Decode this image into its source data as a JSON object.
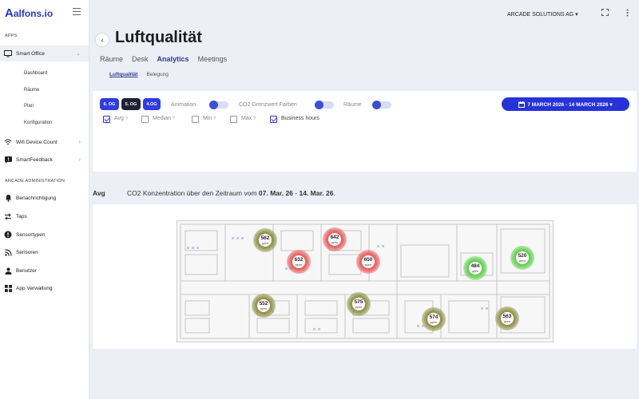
{
  "app": {
    "logo_mark": "A",
    "logo_text": "alfons.io",
    "org": "ARCADE SOLUTIONS AG ▾"
  },
  "sidebar": {
    "apps_label": "APPS",
    "smart_office": "Smart Office",
    "sub_items": [
      "Dashboard",
      "Räume",
      "Plan",
      "Konfiguration"
    ],
    "wifi": "Wifi Device Count",
    "smartfeedback": "SmartFeedback",
    "admin_label": "ARCADE ADMINISTRATION",
    "admin_items": [
      "Benachrichtigung",
      "Taps",
      "Sensortypen",
      "Sensoren",
      "Benutzer",
      "App Verwaltung"
    ]
  },
  "header": {
    "title": "Luftqualität",
    "tabs": [
      "Räume",
      "Desk",
      "Analytics",
      "Meetings"
    ],
    "active_tab": "Analytics",
    "subtabs": [
      "Luftqualität",
      "Belegung"
    ]
  },
  "filters": {
    "floors": [
      "6. OG",
      "5. OG",
      "4.OG"
    ],
    "animation": "Animation",
    "co2_colors": "CO2 Grenzwert Farben",
    "rooms": "Räume",
    "date_range": "7 MARCH 2026 - 14 MARCH 2026 ▾",
    "checkboxes": [
      {
        "label": "Avg",
        "checked": true
      },
      {
        "label": "Median",
        "checked": false
      },
      {
        "label": "Min",
        "checked": false
      },
      {
        "label": "Max",
        "checked": false
      },
      {
        "label": "Business hours",
        "checked": true
      }
    ]
  },
  "summary": {
    "metric": "Avg",
    "prefix": "CO2 Konzentration über den Zeitraum vom ",
    "from": "07. Mar. 26",
    "dash": " - ",
    "to": "14. Mar. 26",
    "suffix": "."
  },
  "sensors": [
    {
      "value": "562",
      "unit": "ppm",
      "level": "olive"
    },
    {
      "value": "642",
      "unit": "ppm",
      "level": "red"
    },
    {
      "value": "632",
      "unit": "ppm",
      "level": "red"
    },
    {
      "value": "650",
      "unit": "ppm",
      "level": "red"
    },
    {
      "value": "484",
      "unit": "ppm",
      "level": "green"
    },
    {
      "value": "520",
      "unit": "ppm",
      "level": "green"
    },
    {
      "value": "552",
      "unit": "ppm",
      "level": "olive"
    },
    {
      "value": "575",
      "unit": "ppm",
      "level": "olive"
    },
    {
      "value": "574",
      "unit": "ppm",
      "level": "olive"
    },
    {
      "value": "563",
      "unit": "ppm",
      "level": "olive"
    }
  ],
  "colors": {
    "accent": "#2633d9",
    "red": "#e85a5a",
    "olive": "#8f8f45",
    "green": "#5fcf4a"
  }
}
